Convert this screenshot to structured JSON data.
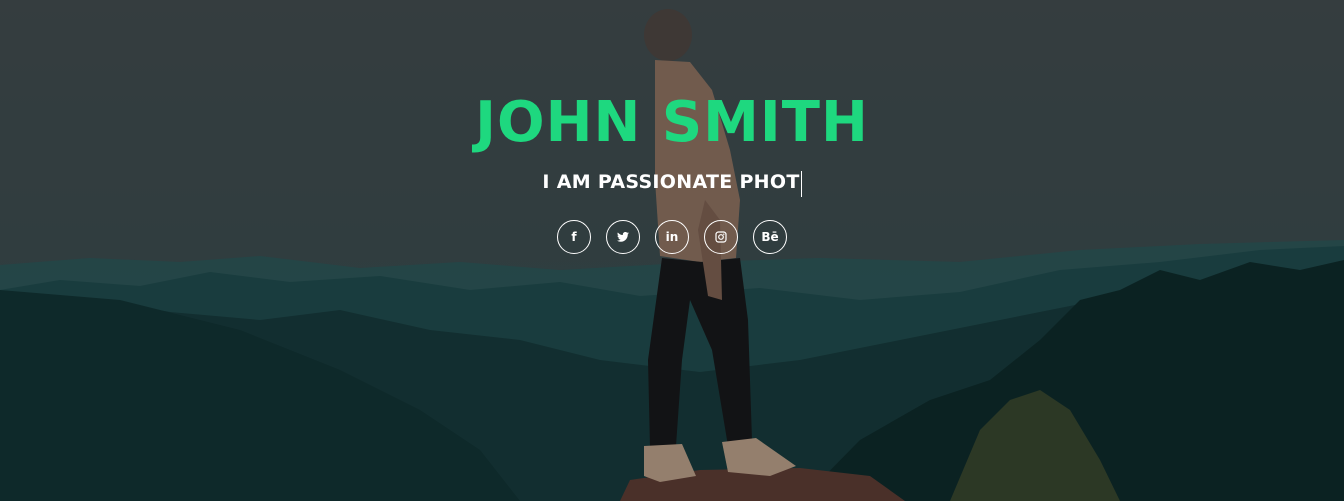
{
  "hero": {
    "name": "JOHN SMITH",
    "tagline": "I AM PASSIONATE PHOT",
    "accent_color": "#1ed87f",
    "text_color": "#ffffff"
  },
  "socials": [
    {
      "icon": "facebook-icon",
      "label": "f"
    },
    {
      "icon": "twitter-icon",
      "label": ""
    },
    {
      "icon": "linkedin-icon",
      "label": "in"
    },
    {
      "icon": "instagram-icon",
      "label": ""
    },
    {
      "icon": "behance-icon",
      "label": "Bē"
    }
  ]
}
